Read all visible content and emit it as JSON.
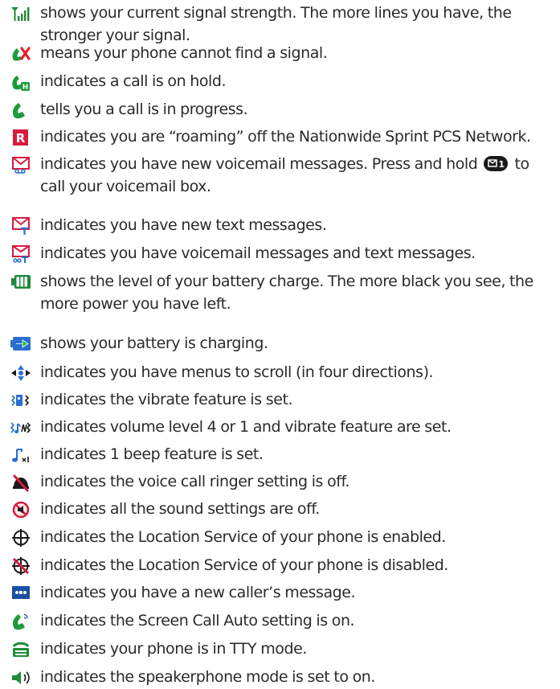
{
  "items": [
    {
      "icon": "signal-strength-icon",
      "text": "shows your current signal strength. The more lines you have, the stronger your signal."
    },
    {
      "icon": "no-signal-icon",
      "text": "means your phone cannot find a signal."
    },
    {
      "icon": "call-on-hold-icon",
      "text": "indicates a call is on hold."
    },
    {
      "icon": "call-in-progress-icon",
      "text": "tells you a call is in progress."
    },
    {
      "icon": "roaming-icon",
      "text": "indicates you are “roaming” off the Nationwide Sprint PCS Network."
    },
    {
      "icon": "new-voicemail-icon",
      "text_before_key": "indicates you have new voicemail messages. Press and hold",
      "key_icon": "voicemail-1-key-icon",
      "text_after_key": "to call your voicemail box."
    },
    {
      "icon": "new-text-message-icon",
      "text": "indicates you have new text messages."
    },
    {
      "icon": "voicemail-and-text-icon",
      "text": "indicates you have voicemail messages and text messages."
    },
    {
      "icon": "battery-level-icon",
      "text": "shows the level of your battery charge. The more black you see, the more power you have left."
    },
    {
      "icon": "battery-charging-icon",
      "text": "shows your battery is charging."
    },
    {
      "icon": "four-way-scroll-icon",
      "text": "indicates you have menus to scroll (in four directions)."
    },
    {
      "icon": "vibrate-icon",
      "text": "indicates the vibrate feature is set."
    },
    {
      "icon": "volume-and-vibrate-icon",
      "text": "indicates volume level 4 or 1 and vibrate feature are set."
    },
    {
      "icon": "one-beep-icon",
      "text": "indicates 1 beep feature is set."
    },
    {
      "icon": "ringer-off-icon",
      "text": "indicates the voice call ringer setting is off."
    },
    {
      "icon": "all-sounds-off-icon",
      "text": "indicates all the sound settings are off."
    },
    {
      "icon": "location-on-icon",
      "text": "indicates the Location Service of your phone is enabled."
    },
    {
      "icon": "location-off-icon",
      "text": "indicates the Location Service of your phone is disabled."
    },
    {
      "icon": "caller-message-icon",
      "text": "indicates you have a new caller’s message."
    },
    {
      "icon": "screen-call-auto-icon",
      "text": "indicates the Screen Call Auto setting is on."
    },
    {
      "icon": "tty-mode-icon",
      "text": "indicates your phone is in TTY mode."
    },
    {
      "icon": "speakerphone-icon",
      "text": "indicates the speakerphone mode is set to on."
    }
  ]
}
